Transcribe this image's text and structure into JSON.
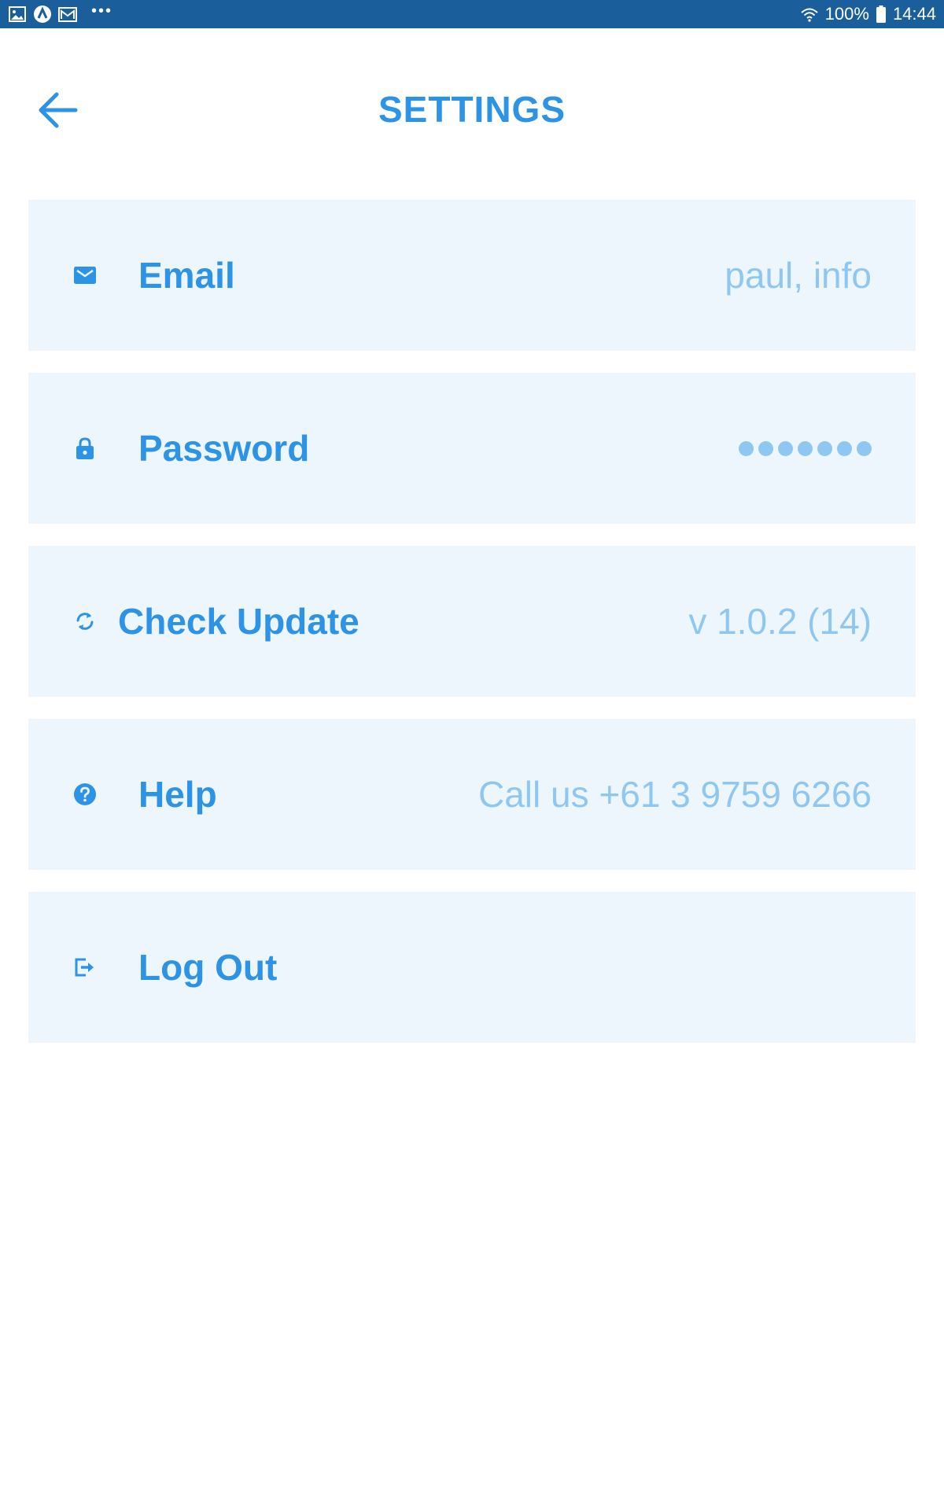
{
  "status_bar": {
    "battery": "100%",
    "time": "14:44",
    "overflow": "•••",
    "icons_left": [
      "image-icon",
      "app-logo-icon",
      "mail-icon"
    ],
    "icons_right": [
      "wifi-icon",
      "battery-icon"
    ]
  },
  "header": {
    "title": "SETTINGS",
    "back_icon": "arrow-left-icon"
  },
  "settings": {
    "items": [
      {
        "id": "email",
        "icon": "mail-icon",
        "label": "Email",
        "value": "paul, info"
      },
      {
        "id": "password",
        "icon": "lock-icon",
        "label": "Password",
        "value": "",
        "masked_length": 7
      },
      {
        "id": "check-update",
        "icon": "refresh-icon",
        "label": "Check Update",
        "value": "v 1.0.2 (14)"
      },
      {
        "id": "help",
        "icon": "help-circle-icon",
        "label": "Help",
        "value": "Call us +61 3 9759 6266"
      },
      {
        "id": "log-out",
        "icon": "logout-icon",
        "label": "Log Out",
        "value": ""
      }
    ]
  },
  "colors": {
    "status_bar_bg": "#1a5f9c",
    "accent": "#2d93e6",
    "value_text": "#8ec7f2",
    "row_bg": "#eef6fd"
  }
}
